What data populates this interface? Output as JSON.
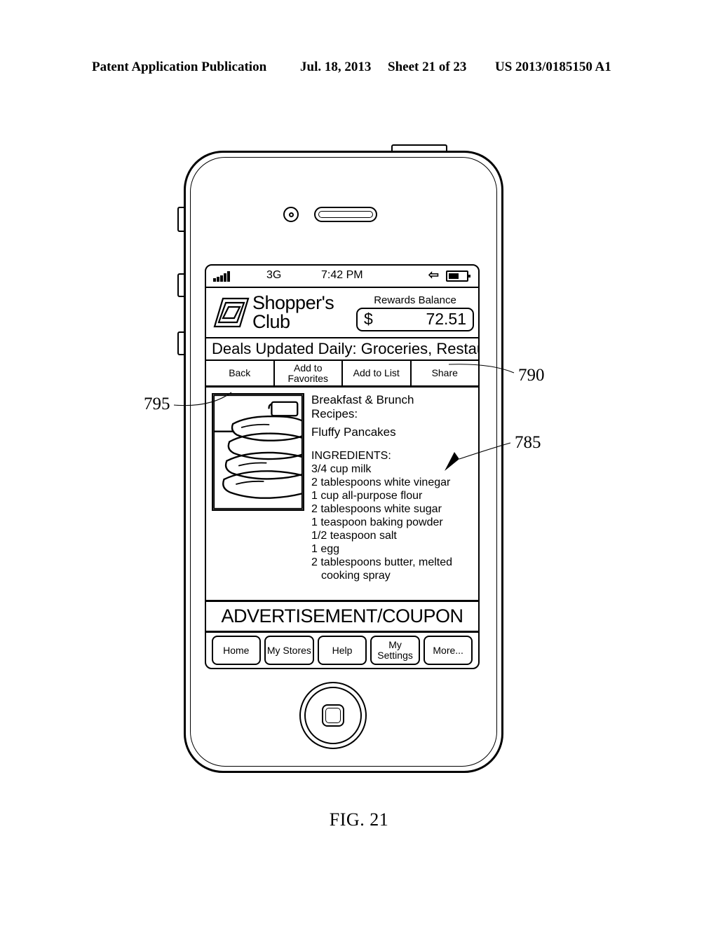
{
  "page_header": {
    "publication": "Patent Application Publication",
    "date": "Jul. 18, 2013",
    "sheet": "Sheet 21 of 23",
    "patent_number": "US 2013/0185150 A1"
  },
  "figure": {
    "caption": "FIG. 21",
    "reference_numerals": [
      {
        "id": "795",
        "label": "795",
        "points_to": "recipe-image"
      },
      {
        "id": "790",
        "label": "790",
        "points_to": "action-toolbar"
      },
      {
        "id": "785",
        "label": "785",
        "points_to": "recipe-content"
      }
    ]
  },
  "device": {
    "type": "smartphone",
    "hardware": {
      "front_camera": "camera-icon",
      "earpiece": "speaker-icon",
      "power_button": "power-button",
      "silent_switch": "silent-switch",
      "volume_up": "volume-up-button",
      "volume_down": "volume-down-button",
      "home_button": "home-button"
    }
  },
  "screen": {
    "status_bar": {
      "signal_icon": "signal-bars-icon",
      "network": "3G",
      "time": "7:42 PM",
      "bluetooth_icon": "bluetooth-icon",
      "battery_icon": "battery-icon"
    },
    "app_header": {
      "logo_icon": "nested-parallelogram-logo",
      "brand_line1": "Shopper's",
      "brand_line2": "Club",
      "rewards_label": "Rewards Balance",
      "rewards_currency": "$",
      "rewards_amount": "72.51"
    },
    "deals_ticker": "Deals Updated Daily: Groceries, Restaur",
    "action_bar": [
      {
        "label": "Back",
        "name": "back-button"
      },
      {
        "label": "Add to Favorites",
        "name": "add-to-favorites-button"
      },
      {
        "label": "Add to List",
        "name": "add-to-list-button"
      },
      {
        "label": "Share",
        "name": "share-button"
      }
    ],
    "content": {
      "image_alt": "pancake-stack-image",
      "heading": "Breakfast & Brunch Recipes:",
      "recipe_title": "Fluffy Pancakes",
      "ingredients_label": "INGREDIENTS:",
      "ingredients": [
        "3/4 cup milk",
        "2 tablespoons white vinegar",
        "1 cup all-purpose flour",
        "2 tablespoons white sugar",
        "1 teaspoon baking powder",
        "1/2 teaspoon salt",
        "1 egg",
        "2 tablespoons butter, melted",
        "cooking spray"
      ]
    },
    "advertisement": "ADVERTISEMENT/COUPON",
    "tab_bar": [
      {
        "label": "Home",
        "name": "tab-home"
      },
      {
        "label": "My Stores",
        "name": "tab-my-stores"
      },
      {
        "label": "Help",
        "name": "tab-help"
      },
      {
        "label": "My Settings",
        "name": "tab-my-settings"
      },
      {
        "label": "More...",
        "name": "tab-more"
      }
    ]
  },
  "colors": {
    "ink": "#000000",
    "paper": "#ffffff"
  }
}
